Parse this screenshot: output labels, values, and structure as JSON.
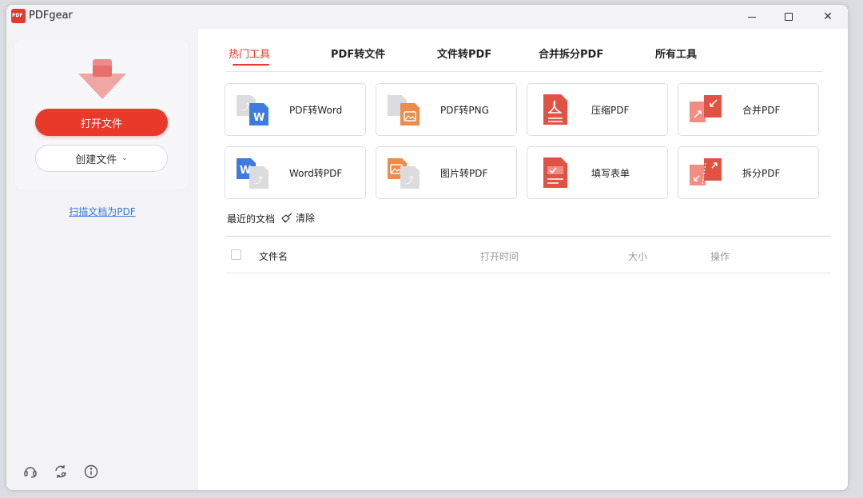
{
  "app": {
    "title": "PDFgear"
  },
  "sidebar": {
    "open_label": "打开文件",
    "create_label": "创建文件",
    "scan_link": "扫描文档为PDF"
  },
  "tabs": [
    {
      "label": "热门工具",
      "active": true
    },
    {
      "label": "PDF转文件",
      "active": false
    },
    {
      "label": "文件转PDF",
      "active": false
    },
    {
      "label": "合并拆分PDF",
      "active": false
    },
    {
      "label": "所有工具",
      "active": false
    }
  ],
  "tools": [
    {
      "label": "PDF转Word",
      "icon": "pdf-to-word-icon"
    },
    {
      "label": "PDF转PNG",
      "icon": "pdf-to-png-icon"
    },
    {
      "label": "压缩PDF",
      "icon": "compress-pdf-icon"
    },
    {
      "label": "合并PDF",
      "icon": "merge-pdf-icon"
    },
    {
      "label": "Word转PDF",
      "icon": "word-to-pdf-icon"
    },
    {
      "label": "图片转PDF",
      "icon": "image-to-pdf-icon"
    },
    {
      "label": "填写表单",
      "icon": "fill-form-icon"
    },
    {
      "label": "拆分PDF",
      "icon": "split-pdf-icon"
    }
  ],
  "recent": {
    "title": "最近的文档",
    "clear_label": "清除",
    "columns": {
      "name": "文件名",
      "opened": "打开时间",
      "size": "大小",
      "action": "操作"
    }
  },
  "colors": {
    "accent": "#e8392b",
    "link": "#3b78d8",
    "word_blue": "#3d7be0",
    "image_orange": "#ee8a4a"
  }
}
